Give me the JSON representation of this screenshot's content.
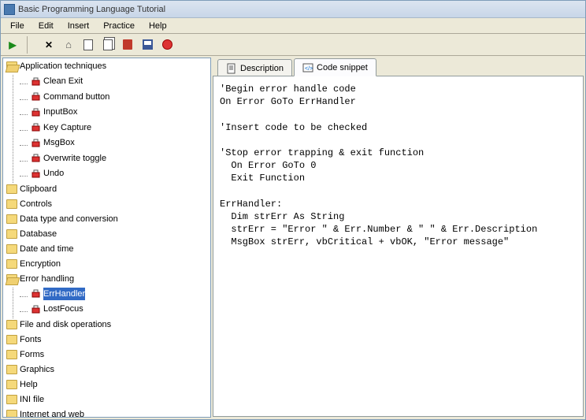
{
  "window": {
    "title": "Basic Programming Language Tutorial"
  },
  "menu": {
    "file": "File",
    "edit": "Edit",
    "insert": "Insert",
    "practice": "Practice",
    "help": "Help"
  },
  "tree": {
    "root": "Application techniques",
    "root_children": {
      "0": "Clean Exit",
      "1": "Command button",
      "2": "InputBox",
      "3": "Key Capture",
      "4": "MsgBox",
      "5": "Overwrite toggle",
      "6": "Undo"
    },
    "folders": {
      "0": "Clipboard",
      "1": "Controls",
      "2": "Data type and conversion",
      "3": "Database",
      "4": "Date and time",
      "5": "Encryption",
      "6": "Error handling",
      "7": "File and disk operations",
      "8": "Fonts",
      "9": "Forms",
      "10": "Graphics",
      "11": "Help",
      "12": "INI file",
      "13": "Internet and web"
    },
    "error_children": {
      "0": "ErrHandler",
      "1": "LostFocus"
    }
  },
  "tabs": {
    "description": "Description",
    "code": "Code snippet"
  },
  "code": "'Begin error handle code\nOn Error GoTo ErrHandler\n\n'Insert code to be checked\n\n'Stop error trapping & exit function\n  On Error GoTo 0\n  Exit Function\n\nErrHandler:\n  Dim strErr As String\n  strErr = \"Error \" & Err.Number & \" \" & Err.Description\n  MsgBox strErr, vbCritical + vbOK, \"Error message\""
}
